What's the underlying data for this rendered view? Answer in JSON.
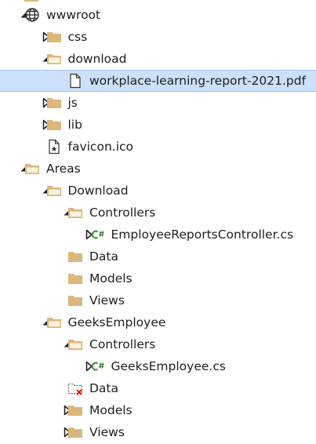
{
  "tree": [
    {
      "label": "wwwroot",
      "icon": "globe-icon",
      "level": 0,
      "expander": "expanded"
    },
    {
      "label": "css",
      "icon": "folder-icon",
      "level": 1,
      "expander": "collapsed"
    },
    {
      "label": "download",
      "icon": "folder-open-icon",
      "level": 1,
      "expander": "expanded"
    },
    {
      "label": "workplace-learning-report-2021.pdf",
      "icon": "file-icon",
      "level": 2,
      "expander": "none",
      "selected": true
    },
    {
      "label": "js",
      "icon": "folder-icon",
      "level": 1,
      "expander": "collapsed"
    },
    {
      "label": "lib",
      "icon": "folder-icon",
      "level": 1,
      "expander": "collapsed"
    },
    {
      "label": "favicon.ico",
      "icon": "favicon-file-icon",
      "level": 1,
      "expander": "none"
    },
    {
      "label": "Areas",
      "icon": "folder-open-icon",
      "level": 0,
      "expander": "expanded"
    },
    {
      "label": "Download",
      "icon": "folder-open-icon",
      "level": 1,
      "expander": "expanded"
    },
    {
      "label": "Controllers",
      "icon": "folder-open-icon",
      "level": 2,
      "expander": "expanded"
    },
    {
      "label": "EmployeeReportsController.cs",
      "icon": "csharp-file-icon",
      "level": 3,
      "expander": "collapsed"
    },
    {
      "label": "Data",
      "icon": "folder-icon",
      "level": 2,
      "expander": "none"
    },
    {
      "label": "Models",
      "icon": "folder-icon",
      "level": 2,
      "expander": "none"
    },
    {
      "label": "Views",
      "icon": "folder-icon",
      "level": 2,
      "expander": "none"
    },
    {
      "label": "GeeksEmployee",
      "icon": "folder-open-icon",
      "level": 1,
      "expander": "expanded"
    },
    {
      "label": "Controllers",
      "icon": "folder-open-icon",
      "level": 2,
      "expander": "expanded"
    },
    {
      "label": "GeeksEmployee.cs",
      "icon": "csharp-file-icon",
      "level": 3,
      "expander": "collapsed"
    },
    {
      "label": "Data",
      "icon": "excluded-folder-icon",
      "level": 2,
      "expander": "none"
    },
    {
      "label": "Models",
      "icon": "folder-icon",
      "level": 2,
      "expander": "collapsed"
    },
    {
      "label": "Views",
      "icon": "folder-icon",
      "level": 2,
      "expander": "collapsed"
    }
  ],
  "colors": {
    "folder": "#dcb67a",
    "selection": "#cce0fa",
    "csharp": "#388a34",
    "excluded_mark": "#e51400"
  }
}
